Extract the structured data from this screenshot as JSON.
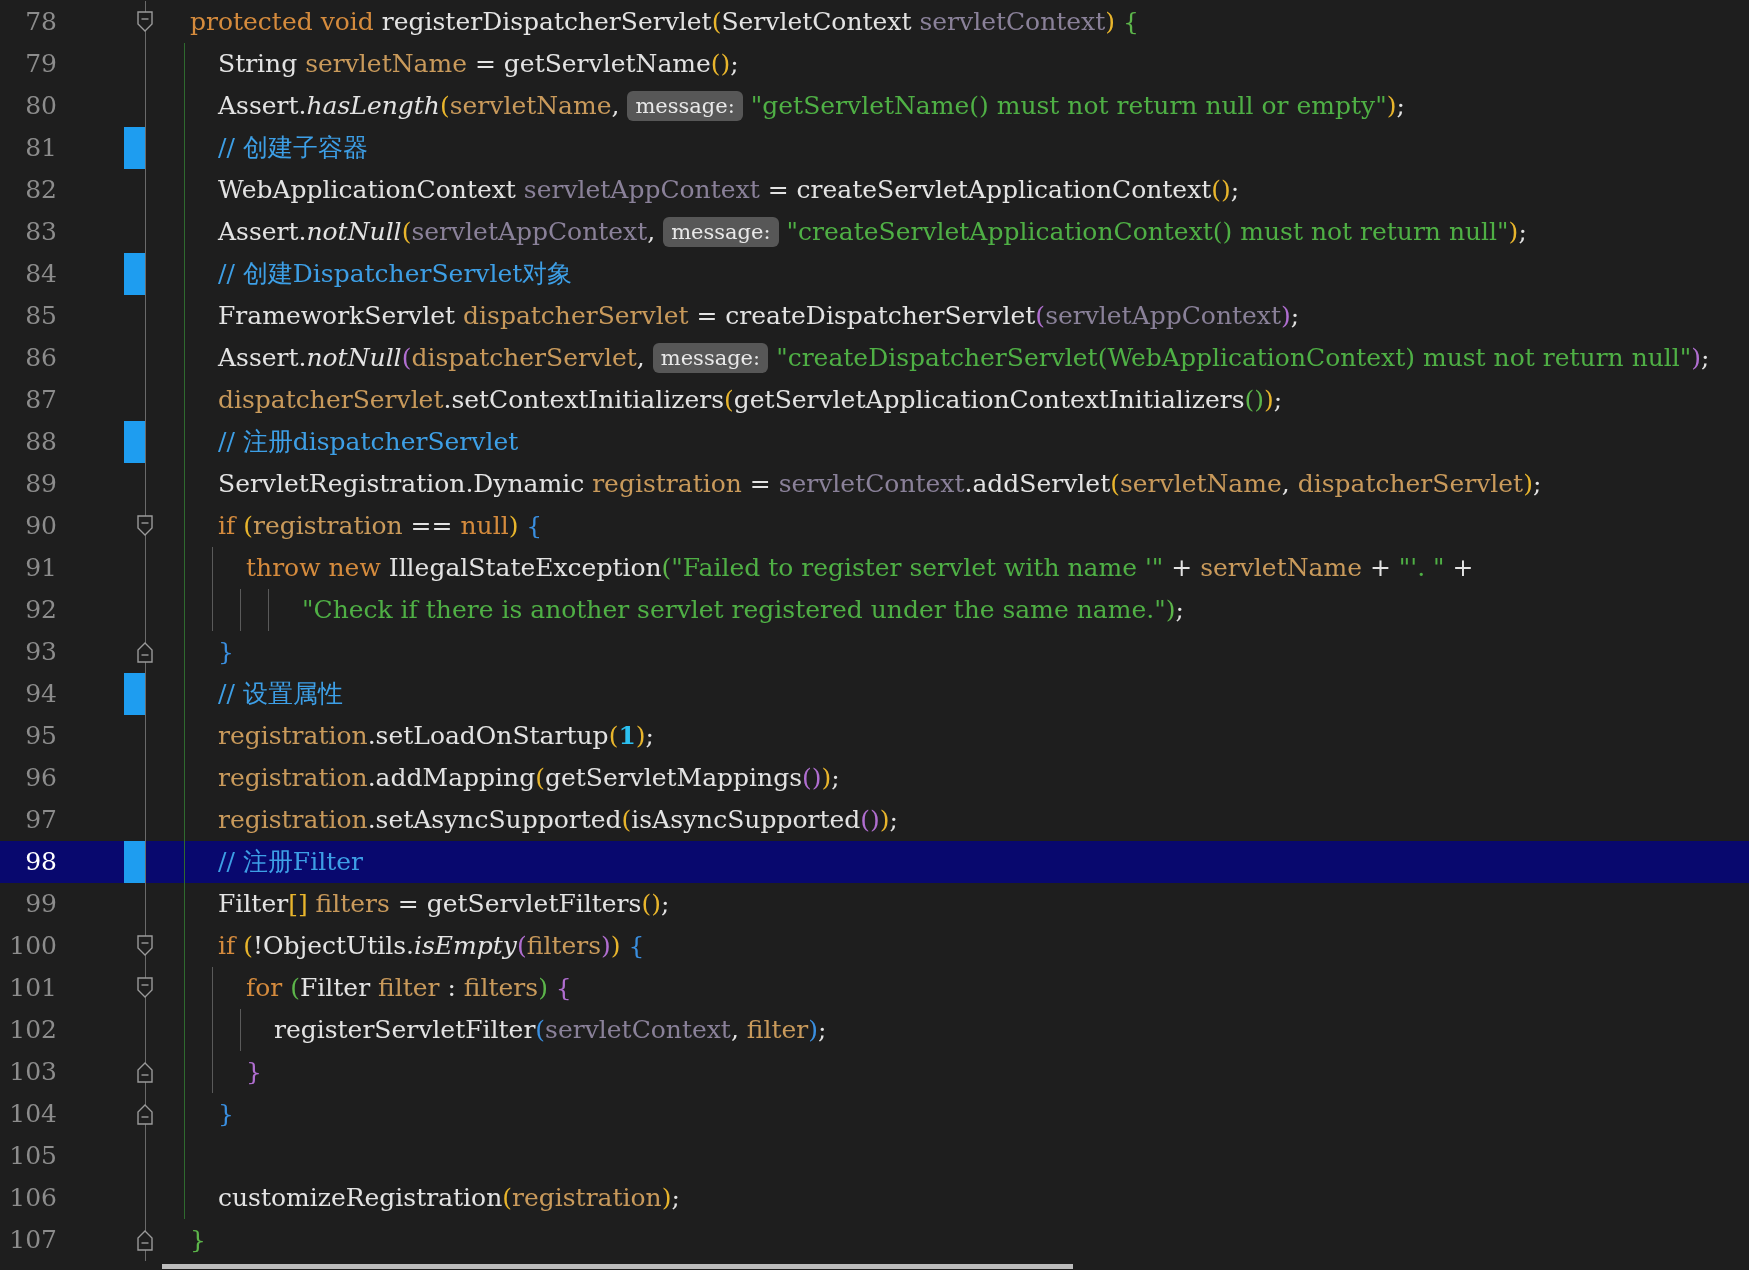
{
  "editor": {
    "lines": [
      {
        "number": "78",
        "changed": false,
        "fold_start": true,
        "fold_end": false,
        "selected": false,
        "tokens": [
          {
            "kind": "keyword",
            "text": "protected void "
          },
          {
            "kind": "text",
            "text": "registerDispatcherServlet"
          },
          {
            "kind": "bracket1",
            "text": "("
          },
          {
            "kind": "text",
            "text": "ServletContext "
          },
          {
            "kind": "param",
            "text": "servletContext"
          },
          {
            "kind": "bracket1",
            "text": ")"
          },
          {
            "kind": "bracket4",
            "text": " {"
          }
        ]
      },
      {
        "number": "79",
        "changed": false,
        "fold_start": false,
        "fold_end": false,
        "selected": false,
        "tokens": [
          {
            "kind": "text",
            "text": "  String "
          },
          {
            "kind": "local",
            "text": "servletName"
          },
          {
            "kind": "text",
            "text": " = getServletName"
          },
          {
            "kind": "bracket1",
            "text": "()"
          },
          {
            "kind": "text",
            "text": ";"
          }
        ]
      },
      {
        "number": "80",
        "changed": false,
        "fold_start": false,
        "fold_end": false,
        "selected": false,
        "tokens": [
          {
            "kind": "text",
            "text": "  Assert."
          },
          {
            "kind": "static",
            "text": "hasLength"
          },
          {
            "kind": "bracket1",
            "text": "("
          },
          {
            "kind": "local",
            "text": "servletName"
          },
          {
            "kind": "text",
            "text": ", "
          },
          {
            "kind": "hint",
            "text": "message:"
          },
          {
            "kind": "string",
            "text": "\"getServletName() must not return null or empty\""
          },
          {
            "kind": "bracket1",
            "text": ")"
          },
          {
            "kind": "text",
            "text": ";"
          }
        ]
      },
      {
        "number": "81",
        "changed": true,
        "fold_start": false,
        "fold_end": false,
        "selected": false,
        "tokens": [
          {
            "kind": "comment",
            "text": "  // 创建子容器"
          }
        ]
      },
      {
        "number": "82",
        "changed": false,
        "fold_start": false,
        "fold_end": false,
        "selected": false,
        "tokens": [
          {
            "kind": "text",
            "text": "  WebApplicationContext "
          },
          {
            "kind": "param",
            "text": "servletAppContext"
          },
          {
            "kind": "text",
            "text": " = createServletApplicationContext"
          },
          {
            "kind": "bracket1",
            "text": "()"
          },
          {
            "kind": "text",
            "text": ";"
          }
        ]
      },
      {
        "number": "83",
        "changed": false,
        "fold_start": false,
        "fold_end": false,
        "selected": false,
        "tokens": [
          {
            "kind": "text",
            "text": "  Assert."
          },
          {
            "kind": "static",
            "text": "notNull"
          },
          {
            "kind": "bracket1",
            "text": "("
          },
          {
            "kind": "param",
            "text": "servletAppContext"
          },
          {
            "kind": "text",
            "text": ", "
          },
          {
            "kind": "hint",
            "text": "message:"
          },
          {
            "kind": "string",
            "text": "\"createServletApplicationContext() must not return null\""
          },
          {
            "kind": "bracket1",
            "text": ")"
          },
          {
            "kind": "text",
            "text": ";"
          }
        ]
      },
      {
        "number": "84",
        "changed": true,
        "fold_start": false,
        "fold_end": false,
        "selected": false,
        "tokens": [
          {
            "kind": "comment",
            "text": "  // 创建DispatcherServlet对象"
          }
        ]
      },
      {
        "number": "85",
        "changed": false,
        "fold_start": false,
        "fold_end": false,
        "selected": false,
        "tokens": [
          {
            "kind": "text",
            "text": "  FrameworkServlet "
          },
          {
            "kind": "local",
            "text": "dispatcherServlet"
          },
          {
            "kind": "text",
            "text": " = createDispatcherServlet"
          },
          {
            "kind": "bracket2",
            "text": "("
          },
          {
            "kind": "param",
            "text": "servletAppContext"
          },
          {
            "kind": "bracket2",
            "text": ")"
          },
          {
            "kind": "text",
            "text": ";"
          }
        ]
      },
      {
        "number": "86",
        "changed": false,
        "fold_start": false,
        "fold_end": false,
        "selected": false,
        "tokens": [
          {
            "kind": "text",
            "text": "  Assert."
          },
          {
            "kind": "static",
            "text": "notNull"
          },
          {
            "kind": "bracket2",
            "text": "("
          },
          {
            "kind": "local",
            "text": "dispatcherServlet"
          },
          {
            "kind": "text",
            "text": ", "
          },
          {
            "kind": "hint",
            "text": "message:"
          },
          {
            "kind": "string",
            "text": "\"createDispatcherServlet(WebApplicationContext) must not return null\""
          },
          {
            "kind": "bracket2",
            "text": ")"
          },
          {
            "kind": "text",
            "text": ";"
          }
        ]
      },
      {
        "number": "87",
        "changed": false,
        "fold_start": false,
        "fold_end": false,
        "selected": false,
        "tokens": [
          {
            "kind": "local",
            "text": "  dispatcherServlet"
          },
          {
            "kind": "text",
            "text": ".setContextInitializers"
          },
          {
            "kind": "bracket1",
            "text": "("
          },
          {
            "kind": "text",
            "text": "getServletApplicationContextInitializers"
          },
          {
            "kind": "bracket4",
            "text": "()"
          },
          {
            "kind": "bracket1",
            "text": ")"
          },
          {
            "kind": "text",
            "text": ";"
          }
        ]
      },
      {
        "number": "88",
        "changed": true,
        "fold_start": false,
        "fold_end": false,
        "selected": false,
        "tokens": [
          {
            "kind": "comment",
            "text": "  // 注册dispatcherServlet"
          }
        ]
      },
      {
        "number": "89",
        "changed": false,
        "fold_start": false,
        "fold_end": false,
        "selected": false,
        "tokens": [
          {
            "kind": "text",
            "text": "  ServletRegistration.Dynamic "
          },
          {
            "kind": "local",
            "text": "registration"
          },
          {
            "kind": "text",
            "text": " = "
          },
          {
            "kind": "param",
            "text": "servletContext"
          },
          {
            "kind": "text",
            "text": ".addServlet"
          },
          {
            "kind": "bracket1",
            "text": "("
          },
          {
            "kind": "local",
            "text": "servletName"
          },
          {
            "kind": "text",
            "text": ", "
          },
          {
            "kind": "local",
            "text": "dispatcherServlet"
          },
          {
            "kind": "bracket1",
            "text": ")"
          },
          {
            "kind": "text",
            "text": ";"
          }
        ]
      },
      {
        "number": "90",
        "changed": false,
        "fold_start": true,
        "fold_end": false,
        "selected": false,
        "tokens": [
          {
            "kind": "keyword",
            "text": "  if "
          },
          {
            "kind": "bracket1",
            "text": "("
          },
          {
            "kind": "local",
            "text": "registration"
          },
          {
            "kind": "text",
            "text": " == "
          },
          {
            "kind": "keyword",
            "text": "null"
          },
          {
            "kind": "bracket1",
            "text": ")"
          },
          {
            "kind": "bracket3",
            "text": " {"
          }
        ]
      },
      {
        "number": "91",
        "changed": false,
        "fold_start": false,
        "fold_end": false,
        "selected": false,
        "tokens": [
          {
            "kind": "keyword",
            "text": "    throw new "
          },
          {
            "kind": "text",
            "text": "IllegalStateException"
          },
          {
            "kind": "bracket4",
            "text": "("
          },
          {
            "kind": "string",
            "text": "\"Failed to register servlet with name '\""
          },
          {
            "kind": "text",
            "text": " + "
          },
          {
            "kind": "local",
            "text": "servletName"
          },
          {
            "kind": "text",
            "text": " + "
          },
          {
            "kind": "string",
            "text": "\"'. \""
          },
          {
            "kind": "text",
            "text": " +"
          }
        ]
      },
      {
        "number": "92",
        "changed": false,
        "fold_start": false,
        "fold_end": false,
        "selected": false,
        "tokens": [
          {
            "kind": "string",
            "text": "        \"Check if there is another servlet registered under the same name.\""
          },
          {
            "kind": "bracket4",
            "text": ")"
          },
          {
            "kind": "text",
            "text": ";"
          }
        ]
      },
      {
        "number": "93",
        "changed": false,
        "fold_start": false,
        "fold_end": true,
        "selected": false,
        "tokens": [
          {
            "kind": "bracket3",
            "text": "  }"
          }
        ]
      },
      {
        "number": "94",
        "changed": true,
        "fold_start": false,
        "fold_end": false,
        "selected": false,
        "tokens": [
          {
            "kind": "comment",
            "text": "  // 设置属性"
          }
        ]
      },
      {
        "number": "95",
        "changed": false,
        "fold_start": false,
        "fold_end": false,
        "selected": false,
        "tokens": [
          {
            "kind": "local",
            "text": "  registration"
          },
          {
            "kind": "text",
            "text": ".setLoadOnStartup"
          },
          {
            "kind": "bracket1",
            "text": "("
          },
          {
            "kind": "number",
            "text": "1"
          },
          {
            "kind": "bracket1",
            "text": ")"
          },
          {
            "kind": "text",
            "text": ";"
          }
        ]
      },
      {
        "number": "96",
        "changed": false,
        "fold_start": false,
        "fold_end": false,
        "selected": false,
        "tokens": [
          {
            "kind": "local",
            "text": "  registration"
          },
          {
            "kind": "text",
            "text": ".addMapping"
          },
          {
            "kind": "bracket1",
            "text": "("
          },
          {
            "kind": "text",
            "text": "getServletMappings"
          },
          {
            "kind": "bracket2",
            "text": "()"
          },
          {
            "kind": "bracket1",
            "text": ")"
          },
          {
            "kind": "text",
            "text": ";"
          }
        ]
      },
      {
        "number": "97",
        "changed": false,
        "fold_start": false,
        "fold_end": false,
        "selected": false,
        "tokens": [
          {
            "kind": "local",
            "text": "  registration"
          },
          {
            "kind": "text",
            "text": ".setAsyncSupported"
          },
          {
            "kind": "bracket1",
            "text": "("
          },
          {
            "kind": "text",
            "text": "isAsyncSupported"
          },
          {
            "kind": "bracket2",
            "text": "()"
          },
          {
            "kind": "bracket1",
            "text": ")"
          },
          {
            "kind": "text",
            "text": ";"
          }
        ]
      },
      {
        "number": "98",
        "changed": true,
        "fold_start": false,
        "fold_end": false,
        "selected": true,
        "tokens": [
          {
            "kind": "comment",
            "text": "  // 注册Filter"
          }
        ]
      },
      {
        "number": "99",
        "changed": false,
        "fold_start": false,
        "fold_end": false,
        "selected": false,
        "tokens": [
          {
            "kind": "text",
            "text": "  Filter"
          },
          {
            "kind": "bracket1",
            "text": "[]"
          },
          {
            "kind": "local",
            "text": " filters"
          },
          {
            "kind": "text",
            "text": " = getServletFilters"
          },
          {
            "kind": "bracket1",
            "text": "()"
          },
          {
            "kind": "text",
            "text": ";"
          }
        ]
      },
      {
        "number": "100",
        "changed": false,
        "fold_start": true,
        "fold_end": false,
        "selected": false,
        "tokens": [
          {
            "kind": "keyword",
            "text": "  if "
          },
          {
            "kind": "bracket1",
            "text": "("
          },
          {
            "kind": "text",
            "text": "!ObjectUtils."
          },
          {
            "kind": "static",
            "text": "isEmpty"
          },
          {
            "kind": "bracket2",
            "text": "("
          },
          {
            "kind": "local",
            "text": "filters"
          },
          {
            "kind": "bracket2",
            "text": ")"
          },
          {
            "kind": "bracket1",
            "text": ")"
          },
          {
            "kind": "bracket3",
            "text": " {"
          }
        ]
      },
      {
        "number": "101",
        "changed": false,
        "fold_start": true,
        "fold_end": false,
        "selected": false,
        "tokens": [
          {
            "kind": "keyword",
            "text": "    for "
          },
          {
            "kind": "bracket4",
            "text": "("
          },
          {
            "kind": "text",
            "text": "Filter "
          },
          {
            "kind": "local",
            "text": "filter"
          },
          {
            "kind": "text",
            "text": " : "
          },
          {
            "kind": "local",
            "text": "filters"
          },
          {
            "kind": "bracket4",
            "text": ")"
          },
          {
            "kind": "bracket2",
            "text": " {"
          }
        ]
      },
      {
        "number": "102",
        "changed": false,
        "fold_start": false,
        "fold_end": false,
        "selected": false,
        "tokens": [
          {
            "kind": "text",
            "text": "      registerServletFilter"
          },
          {
            "kind": "bracket3",
            "text": "("
          },
          {
            "kind": "param",
            "text": "servletContext"
          },
          {
            "kind": "text",
            "text": ", "
          },
          {
            "kind": "local",
            "text": "filter"
          },
          {
            "kind": "bracket3",
            "text": ")"
          },
          {
            "kind": "text",
            "text": ";"
          }
        ]
      },
      {
        "number": "103",
        "changed": false,
        "fold_start": false,
        "fold_end": true,
        "selected": false,
        "tokens": [
          {
            "kind": "bracket2",
            "text": "    }"
          }
        ]
      },
      {
        "number": "104",
        "changed": false,
        "fold_start": false,
        "fold_end": true,
        "selected": false,
        "tokens": [
          {
            "kind": "bracket3",
            "text": "  }"
          }
        ]
      },
      {
        "number": "105",
        "changed": false,
        "fold_start": false,
        "fold_end": false,
        "selected": false
      },
      {
        "number": "106",
        "changed": false,
        "fold_start": false,
        "fold_end": false,
        "selected": false,
        "tokens": [
          {
            "kind": "text",
            "text": "  customizeRegistration"
          },
          {
            "kind": "bracket1",
            "text": "("
          },
          {
            "kind": "local",
            "text": "registration"
          },
          {
            "kind": "bracket1",
            "text": ")"
          },
          {
            "kind": "text",
            "text": ";"
          }
        ]
      },
      {
        "number": "107",
        "changed": false,
        "fold_start": false,
        "fold_end": true,
        "selected": false,
        "tokens": [
          {
            "kind": "bracket4",
            "text": "}"
          }
        ]
      }
    ]
  }
}
